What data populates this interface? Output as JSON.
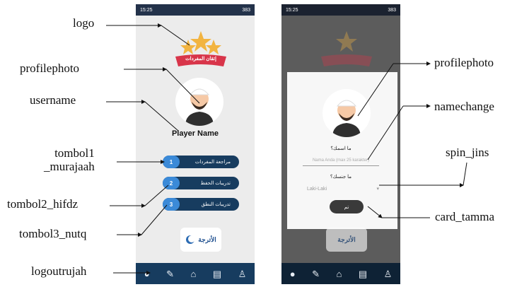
{
  "status_bar": {
    "time": "15:25",
    "signal": "2al",
    "battery": "383"
  },
  "left_screen": {
    "logo_text": "إتقان المفردات",
    "player_name": "Player Name",
    "menu": [
      {
        "num": "1",
        "label": "مراجعة المفردات"
      },
      {
        "num": "2",
        "label": "تدريبات الحفظ"
      },
      {
        "num": "3",
        "label": "تدريبات النطق"
      }
    ],
    "logout_logo": "الأترجة"
  },
  "right_screen": {
    "name_label": "ما اسمك؟",
    "name_placeholder": "Nama Anda (max 25 karakter)",
    "gender_label": "ما جنسك؟",
    "gender_value": "Laki-Laki",
    "ok_label": "تم"
  },
  "nav_icons": [
    "mic-icon",
    "edit-icon",
    "home-icon",
    "document-icon",
    "user-icon"
  ],
  "annotations": {
    "logo": "logo",
    "profilephoto_left": "profilephoto",
    "username": "username",
    "tombol1": "tombol1\n_murajaah",
    "tombol2": "tombol2_hifdz",
    "tombol3": "tombol3_nutq",
    "logout": "logoutrujah",
    "profilephoto_right": "profilephoto",
    "namechange": "namechange",
    "spin": "spin_jins",
    "card": "card_tamma"
  },
  "colors": {
    "navy": "#173c5f",
    "accent": "#3b8ad8",
    "ribbon": "#d8354a",
    "star": "#f2b441"
  }
}
